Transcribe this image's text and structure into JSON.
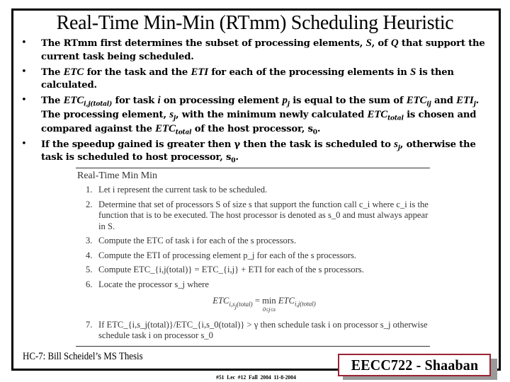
{
  "slide": {
    "title": "Real-Time Min-Min (RTmm) Scheduling Heuristic",
    "bullets": [
      {
        "parts": [
          "The RTmm first determines the subset of processing elements, ",
          "S",
          ", of ",
          "Q",
          " that support the current task being scheduled."
        ]
      },
      {
        "parts": [
          "The ",
          "ETC",
          " for the task and the ",
          "ETI",
          " for each of the processing elements in ",
          "S",
          " is then calculated."
        ]
      },
      {
        "parts": [
          "The ",
          "ETC",
          "i,j(total)",
          " for task ",
          "i",
          " on processing element ",
          "p",
          "j",
          " is equal to the sum of ",
          "ETC",
          "ij",
          " and ",
          "ETI",
          "j",
          ".  The processing element, ",
          "s",
          "j",
          ", with the minimum newly calculated ",
          "ETC",
          "total",
          " is chosen and compared against the ",
          "ETC",
          "total",
          " of the host processor,  s",
          "0",
          "."
        ]
      },
      {
        "parts": [
          " If the speedup gained is greater then ",
          "γ",
          " then the task is scheduled to ",
          "s",
          "j",
          ", otherwise the task is scheduled to host processor, s",
          "0",
          "."
        ]
      }
    ],
    "bullet_symbol": "•"
  },
  "figure": {
    "title": "Real-Time Min Min",
    "steps": [
      {
        "num": "1.",
        "text": "Let i represent the current task to be scheduled."
      },
      {
        "num": "2.",
        "text": "Determine that set of processors S of size s that support the function call c_i where c_i is the function that is to be executed. The host processor is denoted as s_0 and must always appear in S."
      },
      {
        "num": "3.",
        "text": "Compute the ETC of task i for each of the s processors."
      },
      {
        "num": "4.",
        "text": "Compute the ETI of processing element p_j for each of the s processors."
      },
      {
        "num": "5.",
        "text": "Compute ETC_{i,j(total)} = ETC_{i,j} + ETI for each of the s processors."
      },
      {
        "num": "6.",
        "text": "Locate the processor s_j where"
      },
      {
        "num": "7.",
        "text": "If ETC_{i,s_j(total)}/ETC_{i,s_0(total)} > γ then schedule task i on processor s_j otherwise schedule task i on processor s_0"
      }
    ],
    "equation": {
      "lhs": "ETC",
      "lhs_sub": "i,s",
      "lhs_sub2": "j",
      "lhs_sub3": "(total)",
      "op": "=",
      "min": "min",
      "min_under": "0≤j≤s",
      "rhs": "ETC",
      "rhs_sub": "i,j(total)"
    }
  },
  "footer": {
    "source": "HC-7: Bill Scheidel’s MS Thesis",
    "badge": "EECC722 - Shaaban",
    "slide_info": "#51   Lec #12   Fall 2004  11-8-2004"
  }
}
